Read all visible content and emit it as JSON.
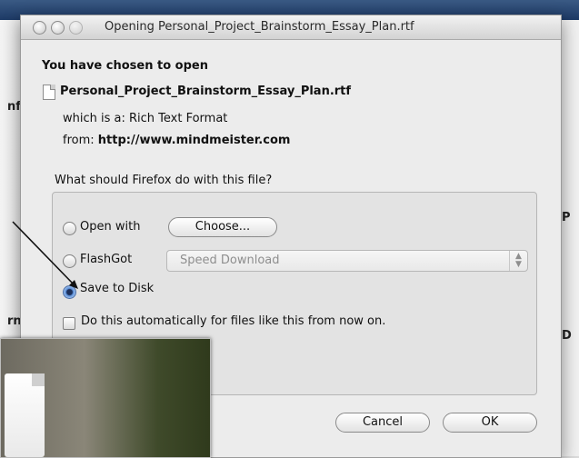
{
  "background": {
    "left_fragment_1": "nf",
    "left_fragment_2": "rn",
    "right_fragment_1": "P",
    "right_fragment_2": "D"
  },
  "dialog": {
    "title": "Opening Personal_Project_Brainstorm_Essay_Plan.rtf",
    "heading": "You have chosen to open",
    "file_name": "Personal_Project_Brainstorm_Essay_Plan.rtf",
    "file_type_prefix": "which is a: ",
    "file_type": "Rich Text Format",
    "from_prefix": "from: ",
    "from_url": "http://www.mindmeister.com",
    "question": "What should Firefox do with this file?",
    "options": {
      "open_with_label": "Open with",
      "choose_button": "Choose...",
      "flashgot_label": "FlashGot",
      "flashgot_select_value": "Speed Download",
      "save_to_disk_label": "Save to Disk",
      "selected": "save_to_disk"
    },
    "auto_checkbox_label": "Do this automatically for files like this from now on.",
    "auto_checked": false,
    "cancel_button": "Cancel",
    "ok_button": "OK"
  },
  "colors": {
    "dialog_bg": "#ececec",
    "selected_radio": "#5b8fd8"
  }
}
